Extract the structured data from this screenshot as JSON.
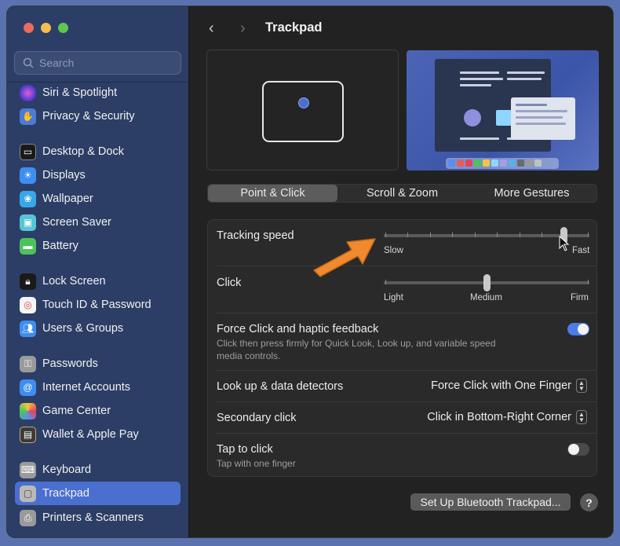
{
  "window": {
    "title": "Trackpad"
  },
  "search": {
    "placeholder": "Search"
  },
  "sidebar": {
    "items": [
      {
        "label": "Siri & Spotlight",
        "icon": "siri-icon",
        "color": "#7a4bd9"
      },
      {
        "label": "Privacy & Security",
        "icon": "hand-icon",
        "color": "#4b7bd9"
      },
      {
        "label": "Desktop & Dock",
        "icon": "dock-icon",
        "color": "#2b2b2b"
      },
      {
        "label": "Displays",
        "icon": "sun-icon",
        "color": "#3d8ef0"
      },
      {
        "label": "Wallpaper",
        "icon": "flower-icon",
        "color": "#38a7e8"
      },
      {
        "label": "Screen Saver",
        "icon": "screensaver-icon",
        "color": "#57c5d6"
      },
      {
        "label": "Battery",
        "icon": "battery-icon",
        "color": "#4cc35a"
      },
      {
        "label": "Lock Screen",
        "icon": "lock-icon",
        "color": "#2b2b2b"
      },
      {
        "label": "Touch ID & Password",
        "icon": "fingerprint-icon",
        "color": "#f5f5f5"
      },
      {
        "label": "Users & Groups",
        "icon": "users-icon",
        "color": "#3d8ef0"
      },
      {
        "label": "Passwords",
        "icon": "key-icon",
        "color": "#9a9a9a"
      },
      {
        "label": "Internet Accounts",
        "icon": "at-icon",
        "color": "#3d8ef0"
      },
      {
        "label": "Game Center",
        "icon": "gamecenter-icon",
        "color": "#f5f5f5"
      },
      {
        "label": "Wallet & Apple Pay",
        "icon": "wallet-icon",
        "color": "#2b2b2b"
      },
      {
        "label": "Keyboard",
        "icon": "keyboard-icon",
        "color": "#9a9a9a"
      },
      {
        "label": "Trackpad",
        "icon": "trackpad-icon",
        "color": "#9a9a9a",
        "active": true
      },
      {
        "label": "Printers & Scanners",
        "icon": "printer-icon",
        "color": "#9a9a9a"
      }
    ]
  },
  "tabs": [
    {
      "label": "Point & Click",
      "active": true
    },
    {
      "label": "Scroll & Zoom",
      "active": false
    },
    {
      "label": "More Gestures",
      "active": false
    }
  ],
  "settings": {
    "tracking_speed": {
      "label": "Tracking speed",
      "min_label": "Slow",
      "max_label": "Fast",
      "value": 0.88
    },
    "click": {
      "label": "Click",
      "labels": [
        "Light",
        "Medium",
        "Firm"
      ],
      "value": 0.5
    },
    "force_click": {
      "label": "Force Click and haptic feedback",
      "description_line1": "Click then press firmly for Quick Look, Look up, and variable speed",
      "description_line2": "media controls.",
      "enabled": true
    },
    "look_up": {
      "label": "Look up & data detectors",
      "value": "Force Click with One Finger"
    },
    "secondary_click": {
      "label": "Secondary click",
      "value": "Click in Bottom-Right Corner"
    },
    "tap_to_click": {
      "label": "Tap to click",
      "description": "Tap with one finger",
      "enabled": false
    }
  },
  "buttons": {
    "setup_bluetooth": "Set Up Bluetooth Trackpad...",
    "help": "?"
  },
  "colors": {
    "accent": "#4a6fcf",
    "annotation_arrow": "#f08a2c"
  }
}
